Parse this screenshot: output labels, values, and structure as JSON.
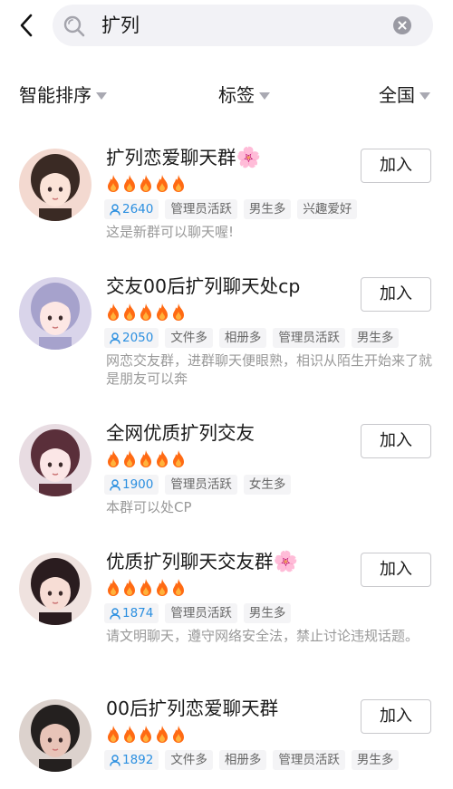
{
  "search": {
    "query": "扩列"
  },
  "filters": [
    {
      "label": "智能排序"
    },
    {
      "label": "标签"
    },
    {
      "label": "全国"
    }
  ],
  "colors": {
    "accent_blue": "#2b8fe0",
    "fire_orange": "#ff6a13",
    "tag_bg": "#f4f4f6",
    "desc_gray": "#999999"
  },
  "groups": [
    {
      "name": "扩列恋爱聊天群",
      "flower": "🌸",
      "heat": 5,
      "members": "2640",
      "tags": [
        "管理员活跃",
        "男生多",
        "兴趣爱好"
      ],
      "description": "这是新群可以聊天喔!",
      "join_label": "加入"
    },
    {
      "name": "交友00后扩列聊天处cp",
      "flower": "",
      "heat": 5,
      "members": "2050",
      "tags": [
        "文件多",
        "相册多",
        "管理员活跃",
        "男生多"
      ],
      "description": "网恋交友群，进群聊天便眼熟，相识从陌生开始来了就是朋友可以奔",
      "join_label": "加入"
    },
    {
      "name": "全网优质扩列交友",
      "flower": "",
      "heat": 5,
      "members": "1900",
      "tags": [
        "管理员活跃",
        "女生多"
      ],
      "description": "本群可以处CP",
      "join_label": "加入"
    },
    {
      "name": "优质扩列聊天交友群",
      "flower": "🌸",
      "heat": 5,
      "members": "1874",
      "tags": [
        "管理员活跃",
        "男生多"
      ],
      "description": "请文明聊天，遵守网络安全法，禁止讨论违规话题。",
      "join_label": "加入"
    },
    {
      "name": "00后扩列恋爱聊天群",
      "flower": "",
      "heat": 5,
      "members": "1892",
      "tags": [
        "文件多",
        "相册多",
        "管理员活跃",
        "男生多"
      ],
      "description": "",
      "join_label": "加入"
    }
  ]
}
